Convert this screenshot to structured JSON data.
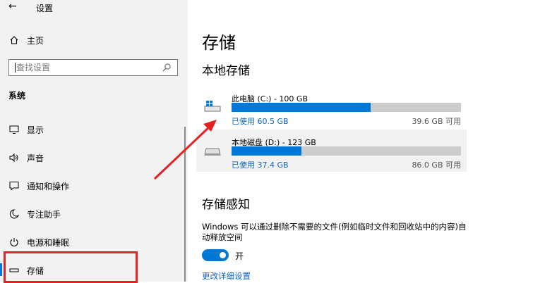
{
  "header": {
    "back_glyph": "←",
    "title": "设置"
  },
  "sidebar": {
    "home_label": "主页",
    "search_placeholder": "查找设置",
    "section_label": "系统",
    "items": [
      {
        "label": "显示",
        "icon": "monitor-icon"
      },
      {
        "label": "声音",
        "icon": "speaker-icon"
      },
      {
        "label": "通知和操作",
        "icon": "notification-icon"
      },
      {
        "label": "专注助手",
        "icon": "moon-icon"
      },
      {
        "label": "电源和睡眠",
        "icon": "power-icon"
      },
      {
        "label": "存储",
        "icon": "storage-icon",
        "selected": true
      }
    ]
  },
  "main": {
    "title": "存储",
    "local_storage_heading": "本地存储",
    "drives": [
      {
        "name": "此电脑 (C:) - 100 GB",
        "used": "已使用 60.5 GB",
        "free": "39.6 GB 可用",
        "used_fraction": 0.605
      },
      {
        "name": "本地磁盘 (D:) - 123 GB",
        "used": "已使用 37.4 GB",
        "free": "86.0 GB 可用",
        "used_fraction": 0.304
      }
    ],
    "storage_sense_heading": "存储感知",
    "storage_sense_desc": "Windows 可以通过删除不需要的文件(例如临时文件和回收站中的内容)自动释放空间",
    "toggle_label": "开",
    "toggle_on": true,
    "link_text": "更改详细设置"
  },
  "colors": {
    "accent": "#0078d7",
    "annotation": "#e52222"
  }
}
